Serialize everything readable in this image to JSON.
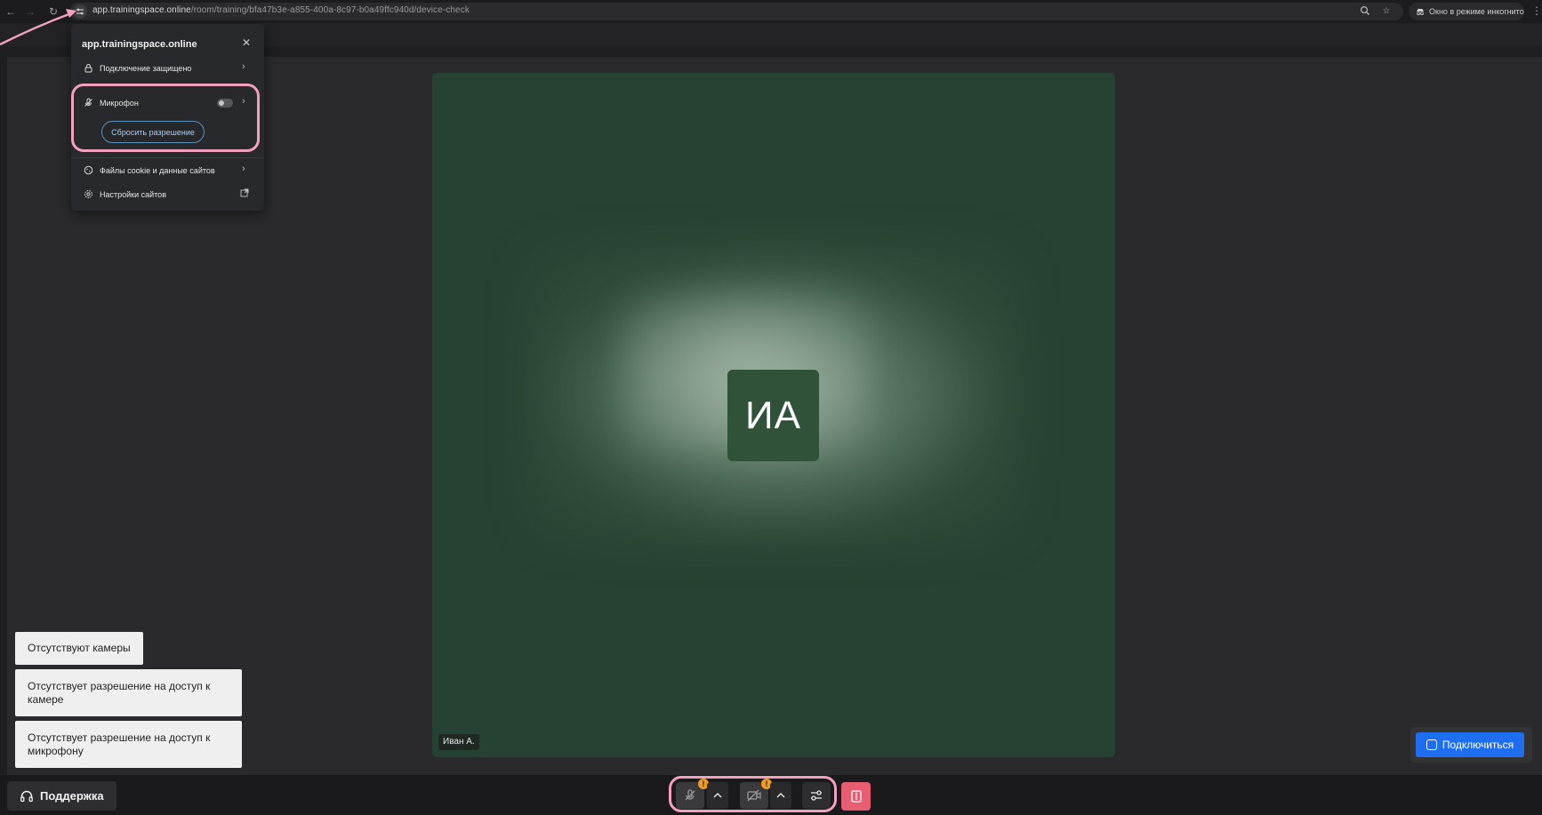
{
  "browser": {
    "url_host": "app.trainingspace.online",
    "url_path": "/room/training/bfa47b3e-a855-400a-8c97-b0a49ffc940d/device-check",
    "incognito_label": "Окно в режиме инкогнито"
  },
  "site_popup": {
    "title": "app.trainingspace.online",
    "connection_label": "Подключение защищено",
    "microphone_label": "Микрофон",
    "reset_permission_label": "Сбросить разрешение",
    "cookies_label": "Файлы cookie и данные сайтов",
    "site_settings_label": "Настройки сайтов"
  },
  "video": {
    "initials": "ИА",
    "participant_name": "Иван А."
  },
  "notifications": [
    "Отсутствуют камеры",
    "Отсутствует разрешение на доступ к камере",
    "Отсутствует разрешение на доступ к микрофону"
  ],
  "buttons": {
    "connect": "Подключиться",
    "support": "Поддержка"
  },
  "warning_badge": "!",
  "colors": {
    "video_bg": "#264232",
    "avatar_bg": "#2f5239",
    "connect_blue": "#1f6df0",
    "leave_red": "#e85d72",
    "highlight_pink": "#f3a0be",
    "warning_orange": "#f29a1f"
  },
  "icons": {
    "back": "arrow-left-icon",
    "forward": "arrow-right-icon",
    "reload": "reload-icon",
    "site_info": "tune-icon",
    "zoom": "zoom-icon",
    "bookmark": "star-icon",
    "incognito": "incognito-icon",
    "menu": "kebab-icon",
    "lock": "lock-icon",
    "mic_off": "mic-off-icon",
    "cookie": "cookie-icon",
    "gear": "gear-icon",
    "external": "external-link-icon",
    "headset": "headset-icon",
    "camera_off": "camera-off-icon",
    "settings_sliders": "sliders-icon",
    "leave": "leave-icon",
    "enter": "enter-icon"
  }
}
